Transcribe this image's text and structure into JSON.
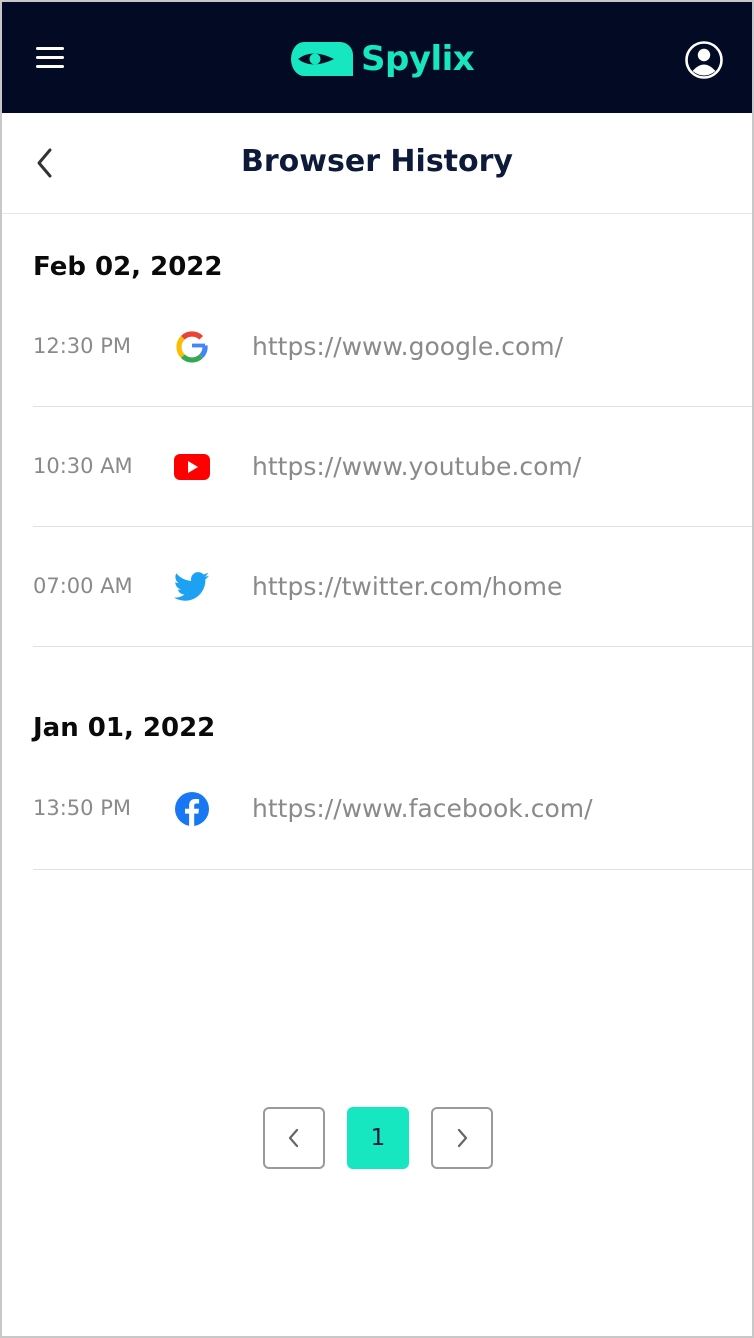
{
  "app": {
    "brand_name": "Spylix",
    "brand_color": "#16e7c0",
    "topbar_color": "#020a24",
    "menu_icon": "hamburger-icon",
    "account_icon": "user-circle-icon"
  },
  "header": {
    "title": "Browser History",
    "back_icon": "chevron-left-icon"
  },
  "history": [
    {
      "date": "Feb 02, 2022",
      "entries": [
        {
          "time": "12:30 PM",
          "icon": "google-icon",
          "url": "https://www.google.com/"
        },
        {
          "time": "10:30 AM",
          "icon": "youtube-icon",
          "url": "https://www.youtube.com/"
        },
        {
          "time": "07:00 AM",
          "icon": "twitter-icon",
          "url": "https://twitter.com/home"
        }
      ]
    },
    {
      "date": "Jan 01, 2022",
      "entries": [
        {
          "time": "13:50 PM",
          "icon": "facebook-icon",
          "url": "https://www.facebook.com/"
        }
      ]
    }
  ],
  "pagination": {
    "current_page": "1",
    "prev_icon": "chevron-left-icon",
    "next_icon": "chevron-right-icon"
  }
}
